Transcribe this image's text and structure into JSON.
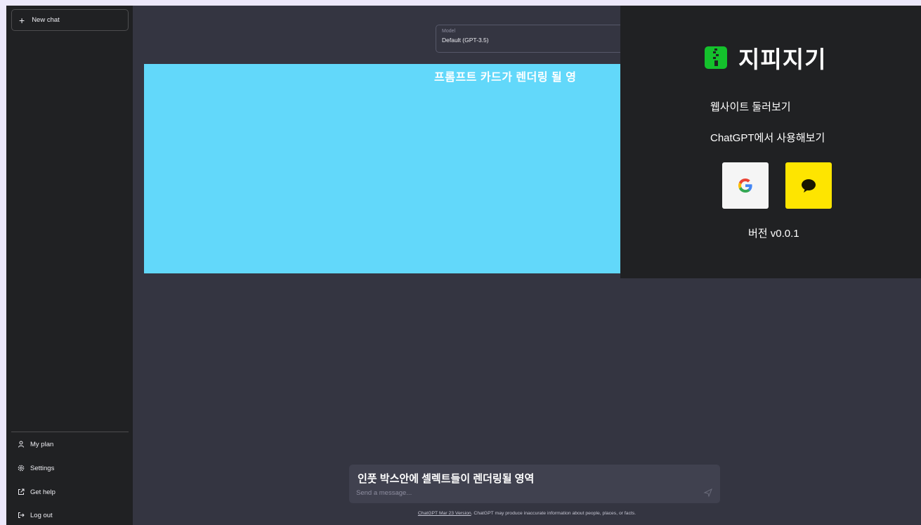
{
  "sidebar": {
    "new_chat_label": "New chat",
    "items": [
      {
        "label": "My plan",
        "icon": "user-icon"
      },
      {
        "label": "Settings",
        "icon": "gear-icon"
      },
      {
        "label": "Get help",
        "icon": "external-link-icon"
      },
      {
        "label": "Log out",
        "icon": "logout-icon"
      }
    ]
  },
  "model": {
    "caption": "Model",
    "value": "Default (GPT-3.5)"
  },
  "prompt_area": {
    "label": "프롬프트 카드가 렌더링 될 영"
  },
  "popup": {
    "title": "지피지기",
    "browse_link": "웹사이트 둘러보기",
    "chatgpt_link": "ChatGPT에서 사용해보기",
    "version": "버전 v0.0.1",
    "colors": {
      "logo": "#14c12c",
      "kakao": "#fee500",
      "google_bg": "#f5f5f5"
    }
  },
  "input": {
    "area_label": "인풋 박스안에 셀렉트들이 렌더링될 영역",
    "placeholder": "Send a message..."
  },
  "footer": {
    "link_text": "ChatGPT Mar 23 Version",
    "text": ". ChatGPT may produce inaccurate information about people, places, or facts."
  }
}
